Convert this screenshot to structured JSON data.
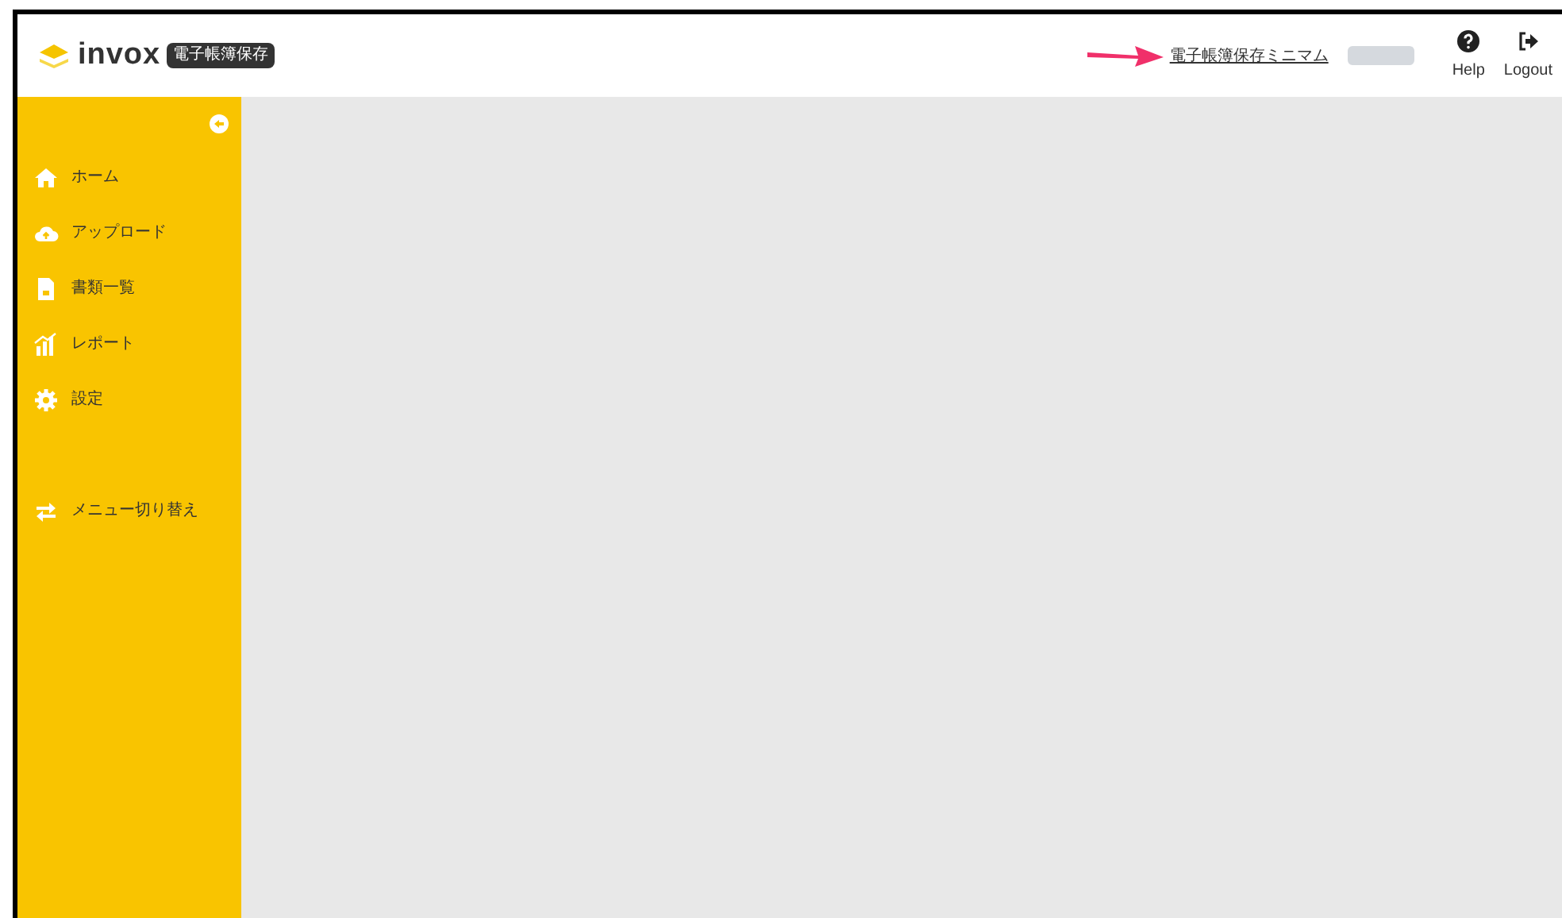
{
  "header": {
    "logo": "invox",
    "badge": "電子帳簿保存",
    "plan_link": "電子帳簿保存ミニマム",
    "actions": [
      {
        "kind": "help",
        "label": "Help"
      },
      {
        "kind": "logout",
        "label": "Logout"
      }
    ]
  },
  "sidebar": {
    "items": [
      {
        "kind": "home",
        "label": "ホーム"
      },
      {
        "kind": "upload",
        "label": "アップロード"
      },
      {
        "kind": "docs",
        "label": "書類一覧"
      },
      {
        "kind": "report",
        "label": "レポート"
      },
      {
        "kind": "settings",
        "label": "設定"
      },
      {
        "kind": "switch",
        "label": "メニュー切り替え"
      }
    ]
  }
}
